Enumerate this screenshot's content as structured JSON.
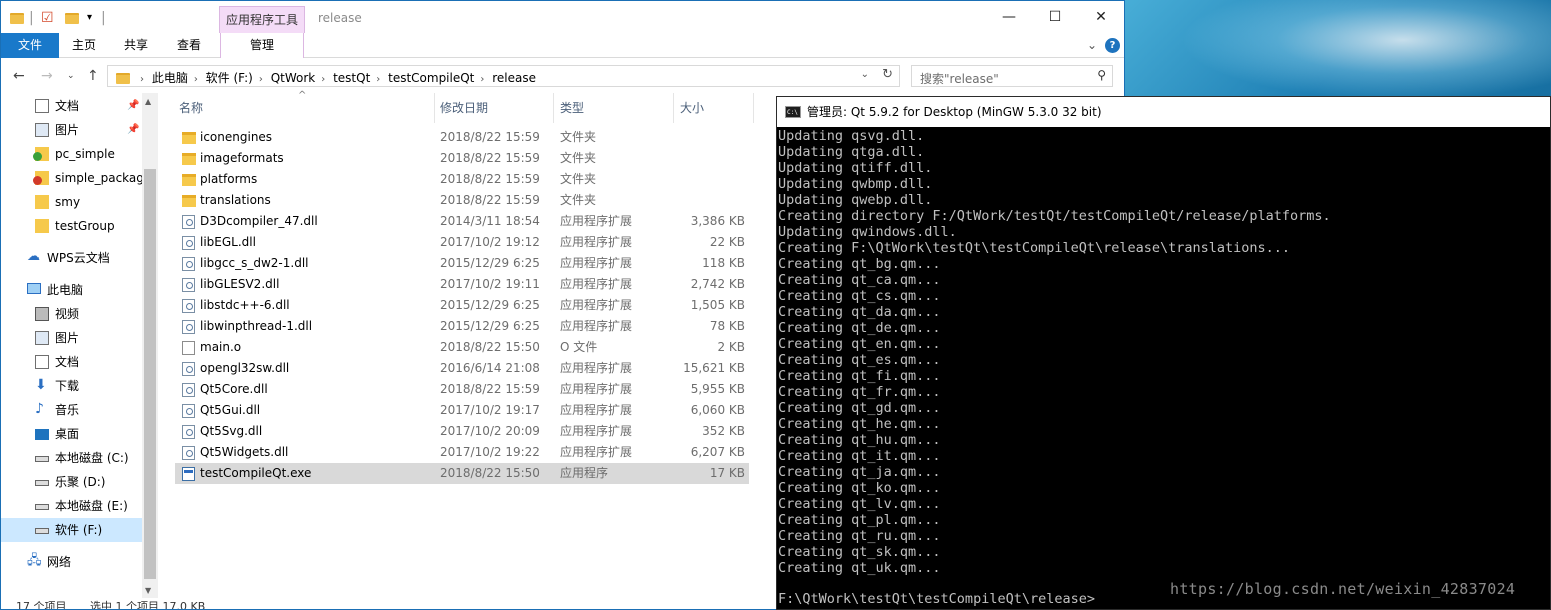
{
  "explorer": {
    "title": "release",
    "context_tab_group": "应用程序工具",
    "ribbon_tabs": {
      "file": "文件",
      "home": "主页",
      "share": "共享",
      "view": "查看",
      "manage": "管理"
    },
    "address": {
      "crumbs": [
        "此电脑",
        "软件 (F:)",
        "QtWork",
        "testQt",
        "testCompileQt",
        "release"
      ]
    },
    "search": {
      "placeholder": "搜索\"release\""
    },
    "nav_pane": {
      "quick_access": [
        {
          "label": "文档",
          "icon": "documents-icon",
          "pinned": true
        },
        {
          "label": "图片",
          "icon": "pictures-icon",
          "pinned": true
        },
        {
          "label": "pc_simple",
          "icon": "folder-check-icon"
        },
        {
          "label": "simple_packag",
          "icon": "folder-error-icon"
        },
        {
          "label": "smy",
          "icon": "folder-icon"
        },
        {
          "label": "testGroup",
          "icon": "folder-icon"
        }
      ],
      "wps": "WPS云文档",
      "this_pc": "此电脑",
      "this_pc_items": [
        {
          "label": "视频",
          "icon": "video-icon"
        },
        {
          "label": "图片",
          "icon": "pictures-icon"
        },
        {
          "label": "文档",
          "icon": "documents-icon"
        },
        {
          "label": "下载",
          "icon": "download-icon"
        },
        {
          "label": "音乐",
          "icon": "music-icon"
        },
        {
          "label": "桌面",
          "icon": "desktop-icon"
        },
        {
          "label": "本地磁盘 (C:)",
          "icon": "drive-icon"
        },
        {
          "label": "乐聚 (D:)",
          "icon": "drive-icon"
        },
        {
          "label": "本地磁盘 (E:)",
          "icon": "drive-icon"
        },
        {
          "label": "软件 (F:)",
          "icon": "drive-icon",
          "selected": true
        }
      ],
      "network": "网络"
    },
    "columns": {
      "name": "名称",
      "date": "修改日期",
      "type": "类型",
      "size": "大小"
    },
    "files": [
      {
        "name": "iconengines",
        "date": "2018/8/22 15:59",
        "type": "文件夹",
        "size": "",
        "icon": "folder"
      },
      {
        "name": "imageformats",
        "date": "2018/8/22 15:59",
        "type": "文件夹",
        "size": "",
        "icon": "folder"
      },
      {
        "name": "platforms",
        "date": "2018/8/22 15:59",
        "type": "文件夹",
        "size": "",
        "icon": "folder"
      },
      {
        "name": "translations",
        "date": "2018/8/22 15:59",
        "type": "文件夹",
        "size": "",
        "icon": "folder"
      },
      {
        "name": "D3Dcompiler_47.dll",
        "date": "2014/3/11 18:54",
        "type": "应用程序扩展",
        "size": "3,386 KB",
        "icon": "dll"
      },
      {
        "name": "libEGL.dll",
        "date": "2017/10/2 19:12",
        "type": "应用程序扩展",
        "size": "22 KB",
        "icon": "dll"
      },
      {
        "name": "libgcc_s_dw2-1.dll",
        "date": "2015/12/29 6:25",
        "type": "应用程序扩展",
        "size": "118 KB",
        "icon": "dll"
      },
      {
        "name": "libGLESV2.dll",
        "date": "2017/10/2 19:11",
        "type": "应用程序扩展",
        "size": "2,742 KB",
        "icon": "dll"
      },
      {
        "name": "libstdc++-6.dll",
        "date": "2015/12/29 6:25",
        "type": "应用程序扩展",
        "size": "1,505 KB",
        "icon": "dll"
      },
      {
        "name": "libwinpthread-1.dll",
        "date": "2015/12/29 6:25",
        "type": "应用程序扩展",
        "size": "78 KB",
        "icon": "dll"
      },
      {
        "name": "main.o",
        "date": "2018/8/22 15:50",
        "type": "O 文件",
        "size": "2 KB",
        "icon": "doc"
      },
      {
        "name": "opengl32sw.dll",
        "date": "2016/6/14 21:08",
        "type": "应用程序扩展",
        "size": "15,621 KB",
        "icon": "dll"
      },
      {
        "name": "Qt5Core.dll",
        "date": "2018/8/22 15:59",
        "type": "应用程序扩展",
        "size": "5,955 KB",
        "icon": "dll"
      },
      {
        "name": "Qt5Gui.dll",
        "date": "2017/10/2 19:17",
        "type": "应用程序扩展",
        "size": "6,060 KB",
        "icon": "dll"
      },
      {
        "name": "Qt5Svg.dll",
        "date": "2017/10/2 20:09",
        "type": "应用程序扩展",
        "size": "352 KB",
        "icon": "dll"
      },
      {
        "name": "Qt5Widgets.dll",
        "date": "2017/10/2 19:22",
        "type": "应用程序扩展",
        "size": "6,207 KB",
        "icon": "dll"
      },
      {
        "name": "testCompileQt.exe",
        "date": "2018/8/22 15:50",
        "type": "应用程序",
        "size": "17 KB",
        "icon": "exe",
        "selected": true
      }
    ],
    "status": {
      "count": "17 个项目",
      "selected": "选中 1 个项目 17.0 KB"
    }
  },
  "console": {
    "title": "管理员: Qt 5.9.2 for Desktop (MinGW 5.3.0 32 bit)",
    "lines": [
      "Updating qsvg.dll.",
      "Updating qtga.dll.",
      "Updating qtiff.dll.",
      "Updating qwbmp.dll.",
      "Updating qwebp.dll.",
      "Creating directory F:/QtWork/testQt/testCompileQt/release/platforms.",
      "Updating qwindows.dll.",
      "Creating F:\\QtWork\\testQt\\testCompileQt\\release\\translations...",
      "Creating qt_bg.qm...",
      "Creating qt_ca.qm...",
      "Creating qt_cs.qm...",
      "Creating qt_da.qm...",
      "Creating qt_de.qm...",
      "Creating qt_en.qm...",
      "Creating qt_es.qm...",
      "Creating qt_fi.qm...",
      "Creating qt_fr.qm...",
      "Creating qt_gd.qm...",
      "Creating qt_he.qm...",
      "Creating qt_hu.qm...",
      "Creating qt_it.qm...",
      "Creating qt_ja.qm...",
      "Creating qt_ko.qm...",
      "Creating qt_lv.qm...",
      "Creating qt_pl.qm...",
      "Creating qt_ru.qm...",
      "Creating qt_sk.qm...",
      "Creating qt_uk.qm..."
    ],
    "prompt": "F:\\QtWork\\testQt\\testCompileQt\\release>"
  },
  "watermark": "https://blog.csdn.net/weixin_42837024"
}
